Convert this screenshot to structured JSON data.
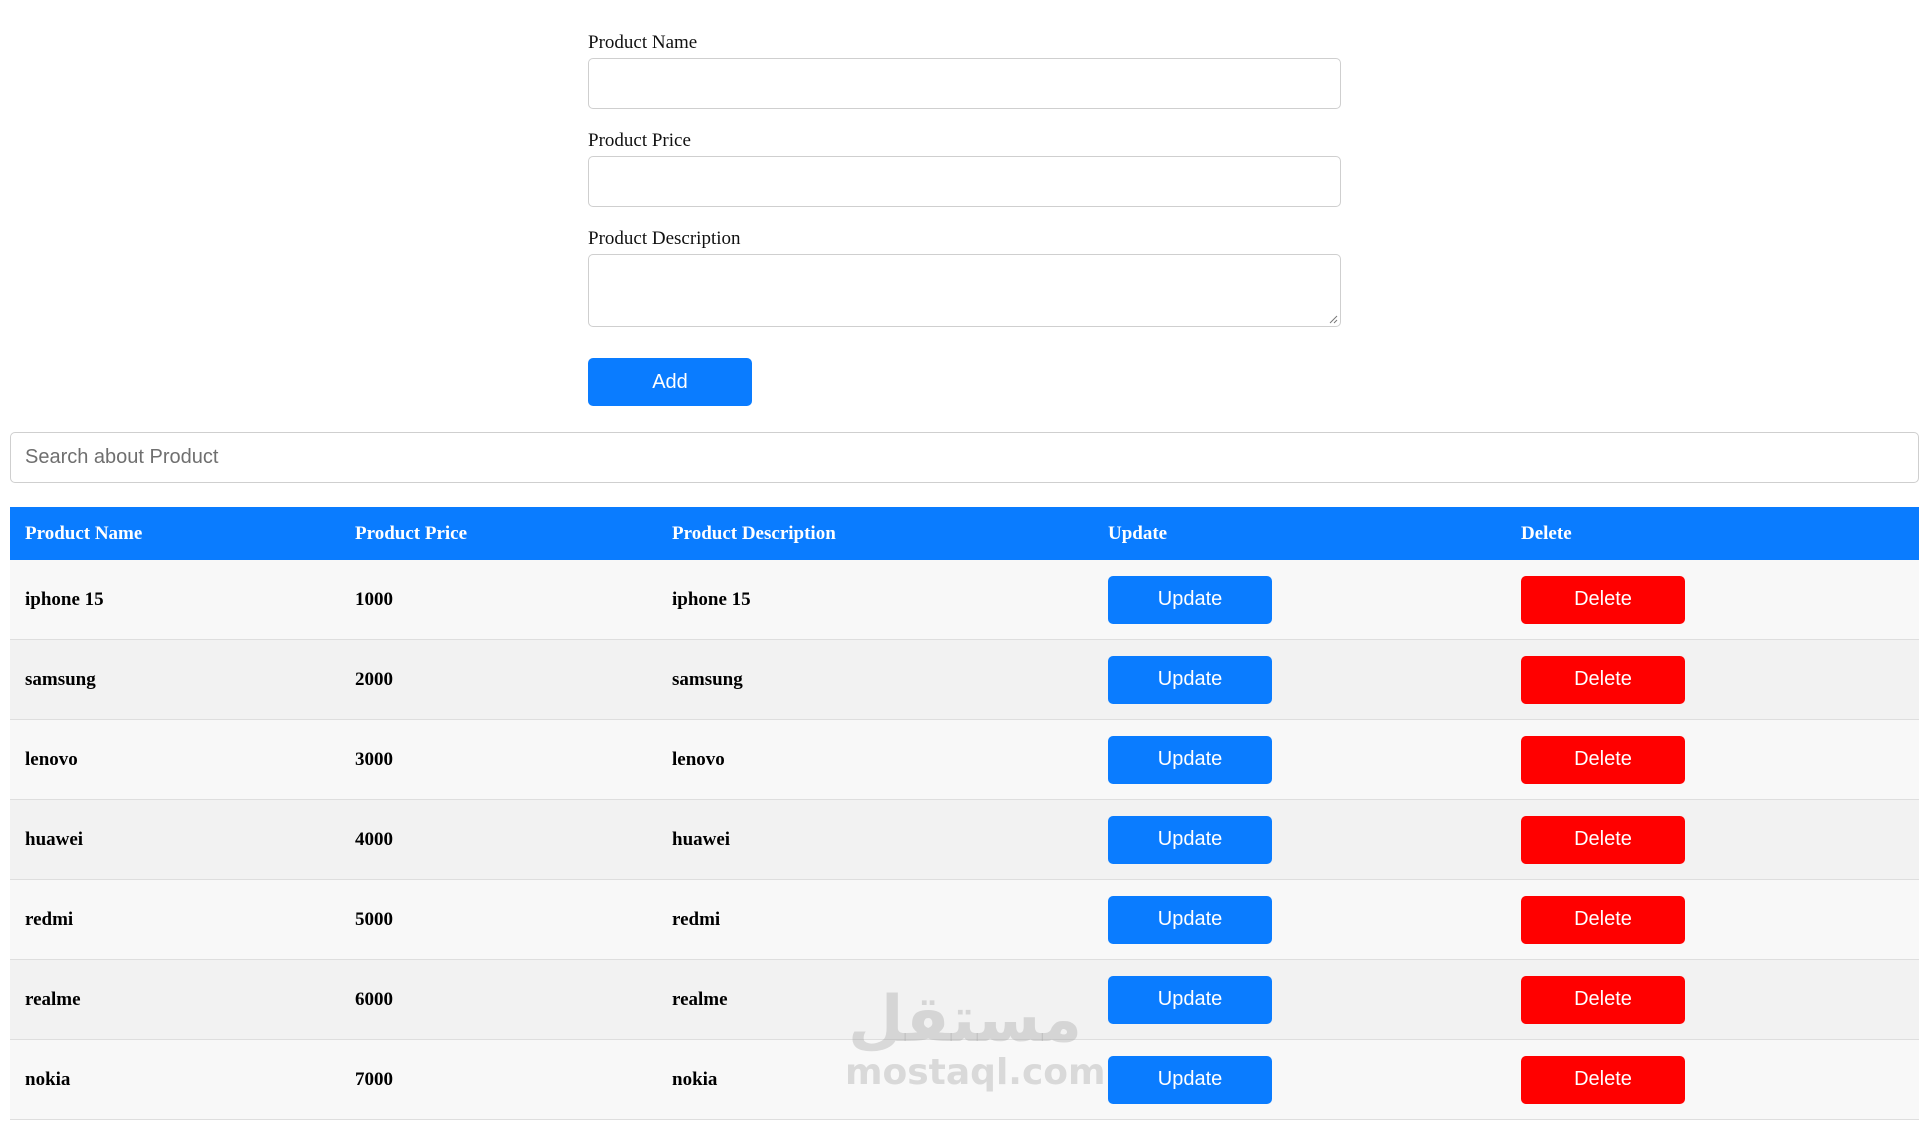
{
  "form": {
    "name_label": "Product Name",
    "price_label": "Product Price",
    "description_label": "Product Description",
    "add_label": "Add"
  },
  "search": {
    "placeholder": "Search about Product"
  },
  "table": {
    "headers": [
      "Product Name",
      "Product Price",
      "Product Description",
      "Update",
      "Delete"
    ],
    "update_label": "Update",
    "delete_label": "Delete",
    "rows": [
      {
        "name": "iphone 15",
        "price": "1000",
        "description": "iphone 15"
      },
      {
        "name": "samsung",
        "price": "2000",
        "description": "samsung"
      },
      {
        "name": "lenovo",
        "price": "3000",
        "description": "lenovo"
      },
      {
        "name": "huawei",
        "price": "4000",
        "description": "huawei"
      },
      {
        "name": "redmi",
        "price": "5000",
        "description": "redmi"
      },
      {
        "name": "realme",
        "price": "6000",
        "description": "realme"
      },
      {
        "name": "nokia",
        "price": "7000",
        "description": "nokia"
      }
    ]
  },
  "watermark": {
    "arabic": "مستقل",
    "latin": "mostaql.com"
  },
  "colors": {
    "primary": "#0a7cff",
    "danger": "#ff0000",
    "row_odd": "#f8f8f8",
    "row_even": "#f2f2f2"
  }
}
